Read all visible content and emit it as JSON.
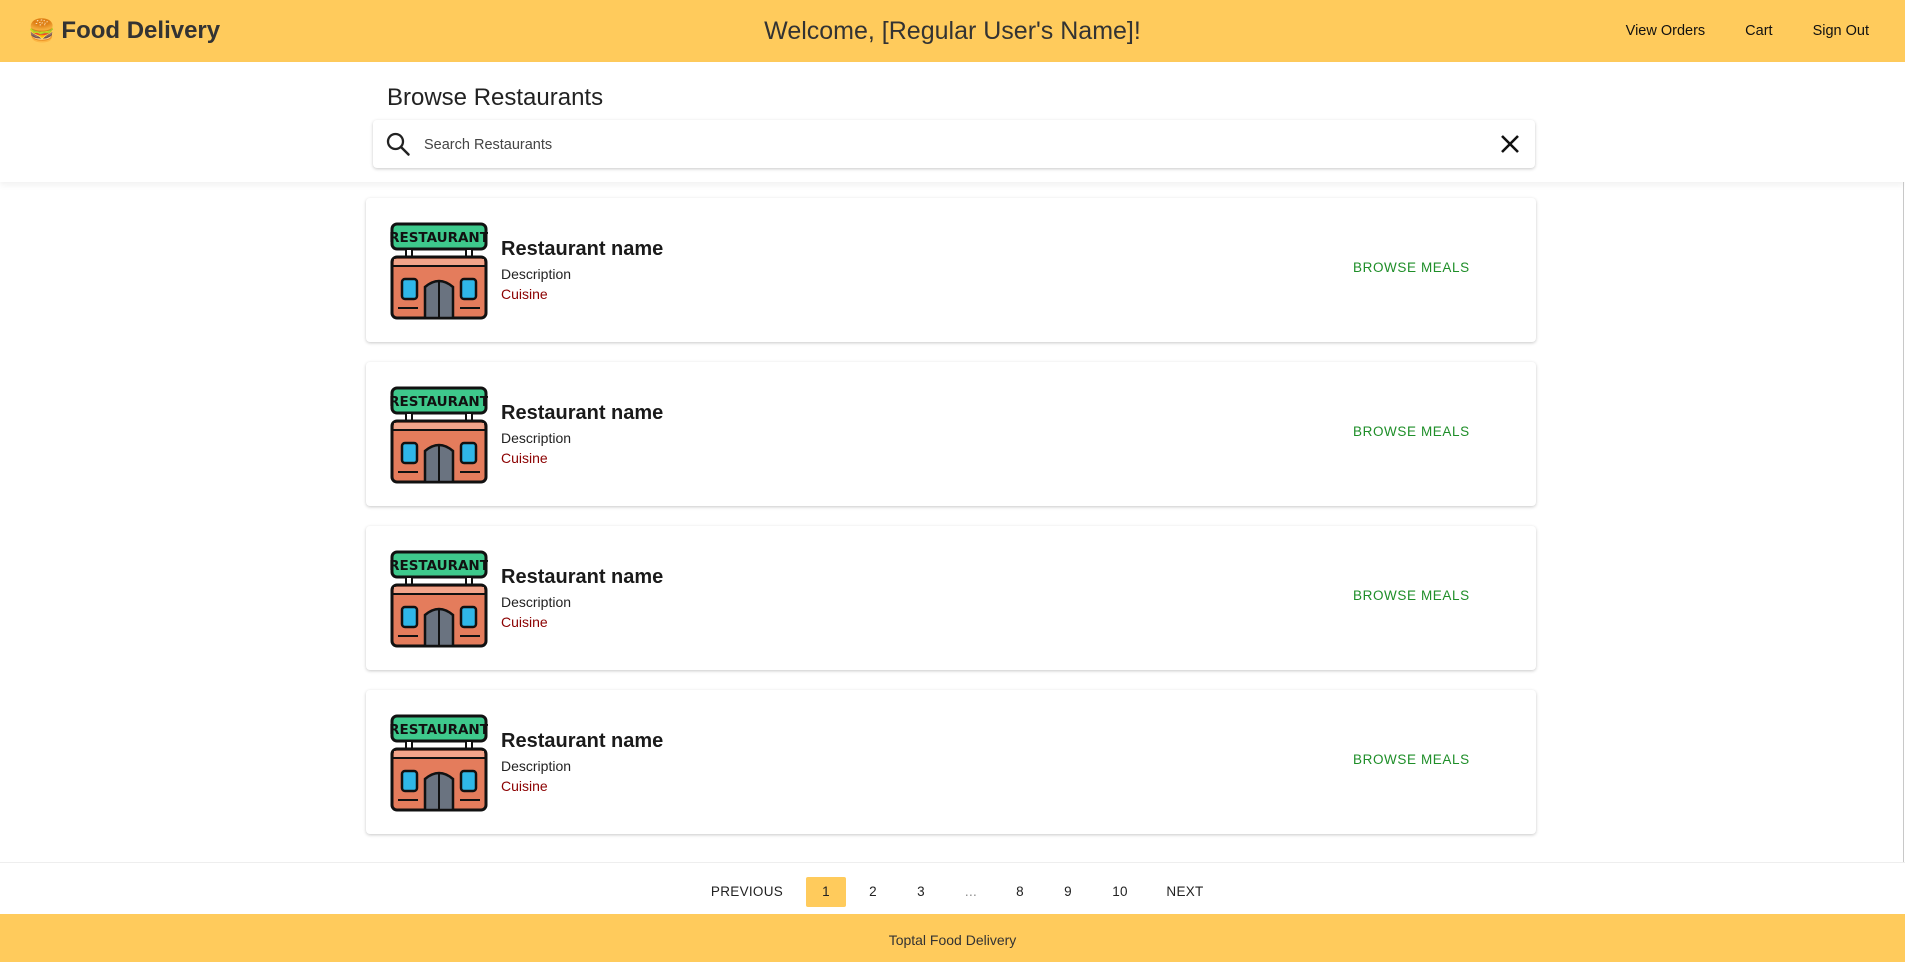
{
  "header": {
    "brand_icon": "🍔",
    "brand_name": "Food Delivery",
    "welcome": "Welcome, [Regular User's Name]!",
    "nav": [
      "View Orders",
      "Cart",
      "Sign Out"
    ],
    "bg_color": "#ffcb5c"
  },
  "search": {
    "title": "Browse Restaurants",
    "placeholder": "Search Restaurants",
    "value": "",
    "search_icon": "search-icon",
    "clear_icon": "close-icon"
  },
  "restaurants": [
    {
      "name": "Restaurant name",
      "description": "Description",
      "cuisine": "Cuisine",
      "action": "BROWSE MEALS",
      "sign": "RESTAURANT"
    },
    {
      "name": "Restaurant name",
      "description": "Description",
      "cuisine": "Cuisine",
      "action": "BROWSE MEALS",
      "sign": "RESTAURANT"
    },
    {
      "name": "Restaurant name",
      "description": "Description",
      "cuisine": "Cuisine",
      "action": "BROWSE MEALS",
      "sign": "RESTAURANT"
    },
    {
      "name": "Restaurant name",
      "description": "Description",
      "cuisine": "Cuisine",
      "action": "BROWSE MEALS",
      "sign": "RESTAURANT"
    }
  ],
  "pagination": {
    "previous": "PREVIOUS",
    "pages": [
      "1",
      "2",
      "3",
      "...",
      "8",
      "9",
      "10"
    ],
    "current": "1",
    "next": "NEXT"
  },
  "footer": {
    "text": "Toptal Food Delivery"
  },
  "colors": {
    "accent": "#ffcb5c",
    "action": "#1e8e28",
    "cuisine": "#8b0000"
  }
}
